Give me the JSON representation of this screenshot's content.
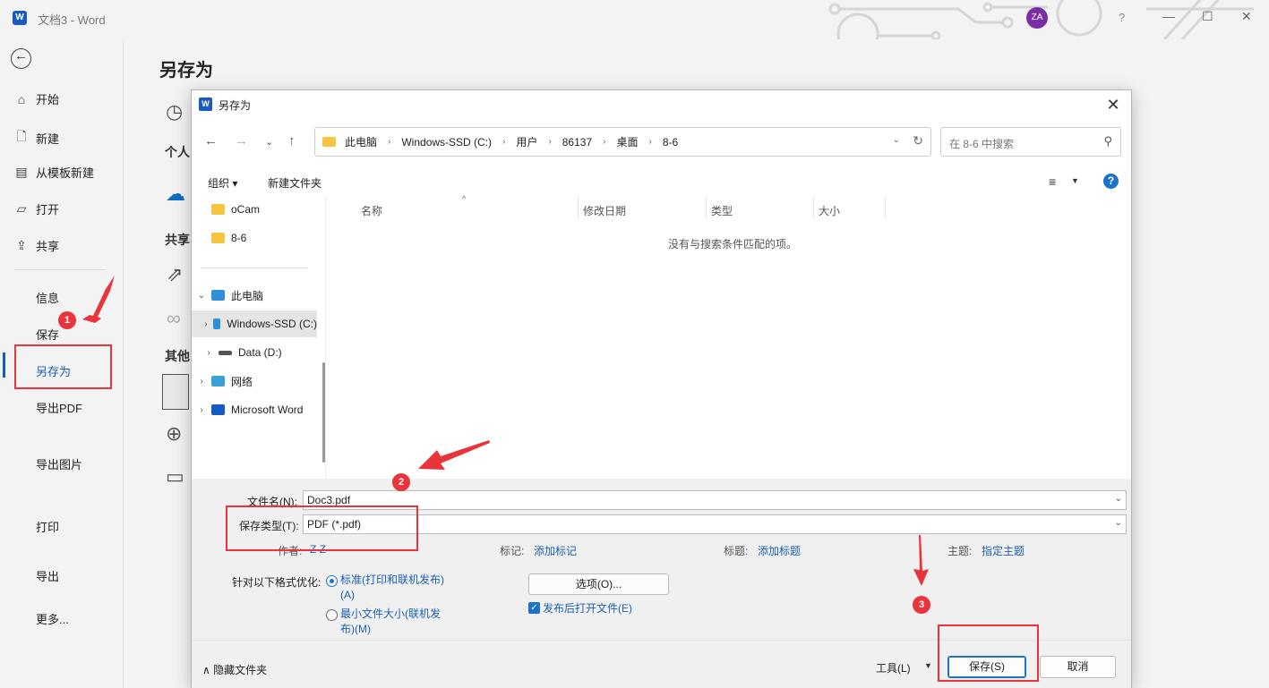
{
  "window": {
    "app_logo": "W",
    "title": "文档3  -  Word",
    "avatar": "ZA",
    "help": "?"
  },
  "backstage": {
    "items": [
      {
        "label": "开始",
        "icon": "home-icon"
      },
      {
        "label": "新建",
        "icon": "new-doc-icon"
      },
      {
        "label": "从模板新建",
        "icon": "template-icon"
      },
      {
        "label": "打开",
        "icon": "open-folder-icon"
      },
      {
        "label": "共享",
        "icon": "share-icon"
      }
    ],
    "plain_items": [
      "信息",
      "保存",
      "另存为",
      "导出PDF",
      "导出图片",
      "打印",
      "导出",
      "更多..."
    ]
  },
  "main": {
    "title": "另存为",
    "partial_labels": [
      "个人",
      "共享",
      "其他"
    ]
  },
  "dialog": {
    "title": "另存为",
    "breadcrumbs": [
      "此电脑",
      "Windows-SSD (C:)",
      "用户",
      "86137",
      "桌面",
      "8-6"
    ],
    "search_placeholder": "在 8-6 中搜索",
    "toolbar": {
      "organize": "组织",
      "new_folder": "新建文件夹"
    },
    "tree": [
      {
        "label": "oCam",
        "icon": "folder",
        "chevron": ""
      },
      {
        "label": "8-6",
        "icon": "folder",
        "chevron": ""
      },
      {
        "label": "此电脑",
        "icon": "pc",
        "chevron": "⌄"
      },
      {
        "label": "Windows-SSD (C:)",
        "icon": "drive",
        "chevron": "›"
      },
      {
        "label": "Data (D:)",
        "icon": "drive",
        "chevron": "›"
      },
      {
        "label": "网络",
        "icon": "network",
        "chevron": "›"
      },
      {
        "label": "Microsoft Word",
        "icon": "word",
        "chevron": "›"
      }
    ],
    "columns": [
      "名称",
      "修改日期",
      "类型",
      "大小"
    ],
    "empty_message": "没有与搜索条件匹配的项。",
    "form": {
      "filename_label": "文件名(N):",
      "filename_value": "Doc3.pdf",
      "filetype_label": "保存类型(T):",
      "filetype_value": "PDF (*.pdf)",
      "author_label": "作者:",
      "author_value": "Z Z",
      "tags_label": "标记:",
      "tags_link": "添加标记",
      "title_label": "标题:",
      "title_link": "添加标题",
      "subject_label": "主题:",
      "subject_link": "指定主题",
      "optimize_label": "针对以下格式优化:",
      "radio_standard_1": "标准(打印和联机发布)",
      "radio_standard_2": "(A)",
      "radio_min_1": "最小文件大小(联机发",
      "radio_min_2": "布)(M)",
      "options_button": "选项(O)...",
      "open_after_label": "发布后打开文件(E)"
    },
    "footer": {
      "hide_folders": "隐藏文件夹",
      "tools": "工具(L)",
      "save": "保存(S)",
      "cancel": "取消"
    }
  },
  "annotations": [
    "1",
    "2",
    "3"
  ],
  "colors": {
    "accent": "#185abd",
    "annotation": "#e8343a",
    "link": "#1a5fb4"
  }
}
